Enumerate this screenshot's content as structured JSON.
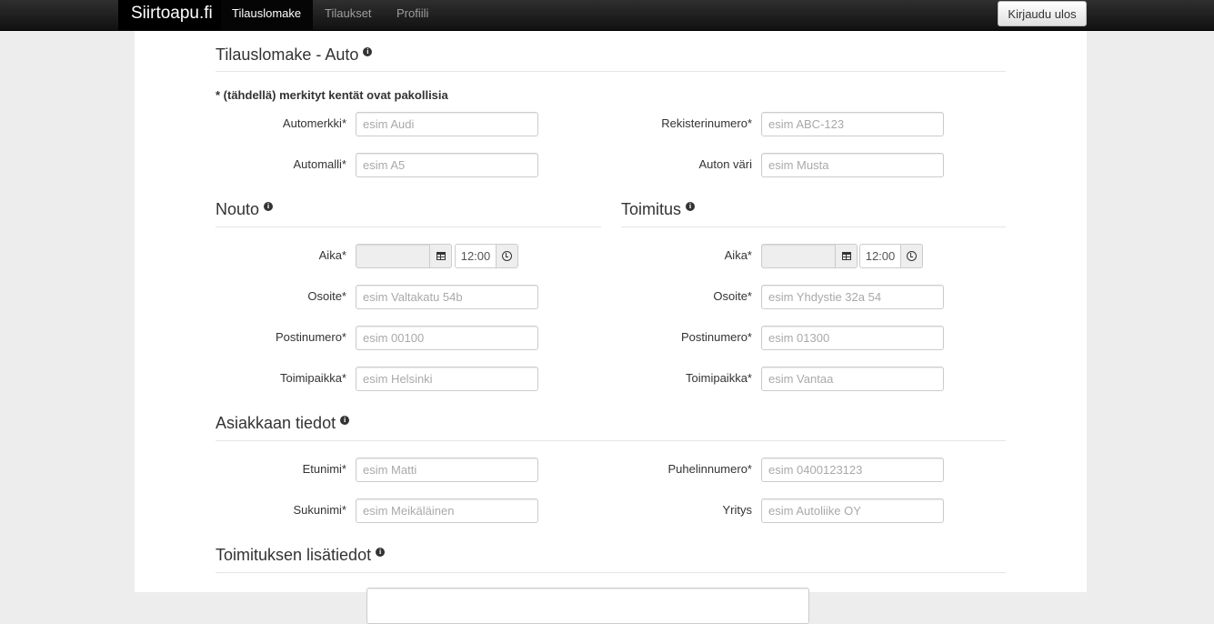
{
  "navbar": {
    "brand": "Siirtoapu.fi",
    "items": [
      {
        "label": "Tilauslomake"
      },
      {
        "label": "Tilaukset"
      },
      {
        "label": "Profiili"
      }
    ],
    "logout_label": "Kirjaudu ulos"
  },
  "form": {
    "title": "Tilauslomake - Auto",
    "required_note": "* (tähdellä) merkityt kentät ovat pakollisia",
    "car": {
      "brand": {
        "label": "Automerkki*",
        "placeholder": "esim Audi"
      },
      "model": {
        "label": "Automalli*",
        "placeholder": "esim A5"
      },
      "plate": {
        "label": "Rekisterinumero*",
        "placeholder": "esim ABC-123"
      },
      "color": {
        "label": "Auton väri",
        "placeholder": "esim Musta"
      }
    },
    "pickup": {
      "title": "Nouto",
      "time": {
        "label": "Aika*",
        "date_value": "",
        "time_value": "12:00"
      },
      "address": {
        "label": "Osoite*",
        "placeholder": "esim Valtakatu 54b"
      },
      "postal": {
        "label": "Postinumero*",
        "placeholder": "esim 00100"
      },
      "city": {
        "label": "Toimipaikka*",
        "placeholder": "esim Helsinki"
      }
    },
    "delivery": {
      "title": "Toimitus",
      "time": {
        "label": "Aika*",
        "date_value": "",
        "time_value": "12:00"
      },
      "address": {
        "label": "Osoite*",
        "placeholder": "esim Yhdystie 32a 54"
      },
      "postal": {
        "label": "Postinumero*",
        "placeholder": "esim 01300"
      },
      "city": {
        "label": "Toimipaikka*",
        "placeholder": "esim Vantaa"
      }
    },
    "customer": {
      "title": "Asiakkaan tiedot",
      "first_name": {
        "label": "Etunimi*",
        "placeholder": "esim Matti"
      },
      "last_name": {
        "label": "Sukunimi*",
        "placeholder": "esim Meikäläinen"
      },
      "phone": {
        "label": "Puhelinnumero*",
        "placeholder": "esim 0400123123"
      },
      "company": {
        "label": "Yritys",
        "placeholder": "esim Autoliike OY"
      }
    },
    "extra": {
      "title": "Toimituksen lisätiedot"
    }
  },
  "icons": {
    "info": "info-icon",
    "calendar": "calendar-icon",
    "clock": "clock-icon"
  }
}
